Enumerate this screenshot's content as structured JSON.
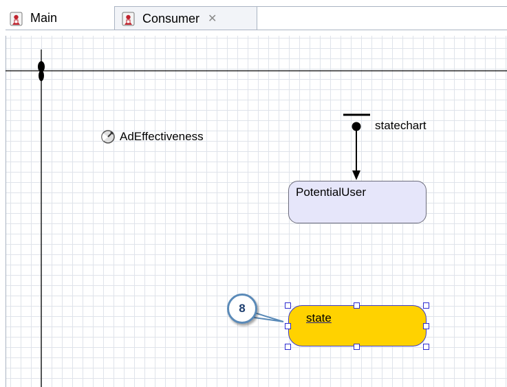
{
  "tabs": [
    {
      "label": "Main"
    },
    {
      "label": "Consumer",
      "close_glyph": "✕"
    }
  ],
  "diagram": {
    "parameter_label": "AdEffectiveness",
    "statechart_label": "statechart",
    "state_potential_label": "PotentialUser",
    "state_new_label": "state"
  },
  "callout": {
    "number": "8"
  },
  "colors": {
    "selected_state_fill": "#ffd200",
    "selection_handle": "#2a2ad0",
    "state_fill": "#e6e6fa",
    "callout_border": "#5a8ab8"
  },
  "icons": {
    "tab_icon": "agent-icon",
    "parameter_icon": "parameter-gauge-icon",
    "close_icon": "close-icon"
  }
}
